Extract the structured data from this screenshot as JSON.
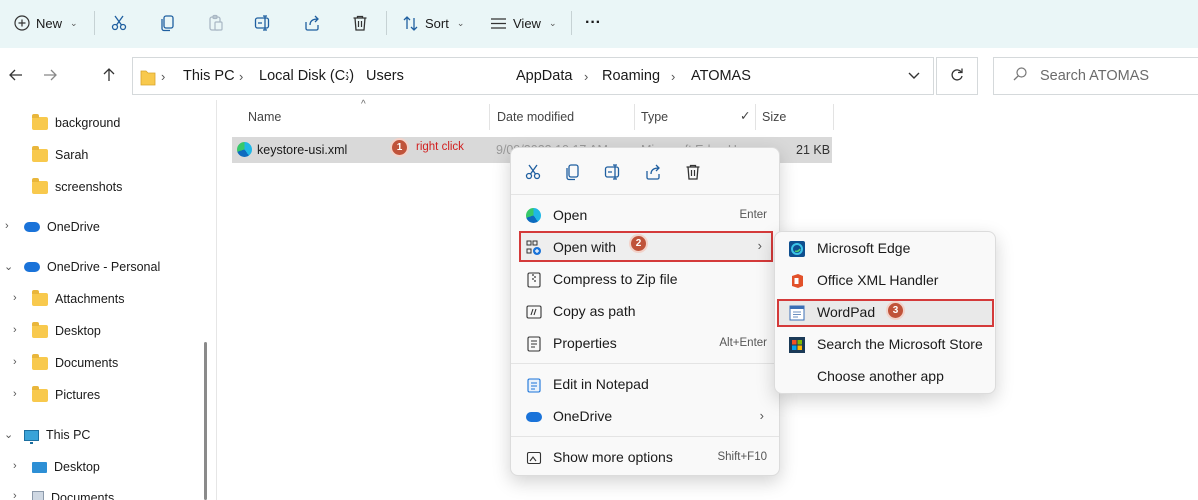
{
  "toolbar": {
    "new_label": "New",
    "sort_label": "Sort",
    "view_label": "View",
    "more_label": "···"
  },
  "address": {
    "crumbs": [
      "This PC",
      "Local Disk (C:)",
      "Users",
      "AppData",
      "Roaming",
      "ATOMAS"
    ],
    "separator": "›"
  },
  "search": {
    "placeholder": "Search ATOMAS"
  },
  "sidebar": {
    "items": [
      {
        "label": "background",
        "icon": "folder-icon"
      },
      {
        "label": "Sarah",
        "icon": "folder-icon"
      },
      {
        "label": "screenshots",
        "icon": "folder-icon"
      },
      {
        "label": "OneDrive",
        "icon": "onedrive-icon"
      },
      {
        "label": "OneDrive - Personal",
        "icon": "onedrive-icon"
      },
      {
        "label": "Attachments",
        "icon": "folder-icon"
      },
      {
        "label": "Desktop",
        "icon": "folder-icon"
      },
      {
        "label": "Documents",
        "icon": "folder-icon"
      },
      {
        "label": "Pictures",
        "icon": "folder-icon"
      },
      {
        "label": "This PC",
        "icon": "this-pc-icon"
      },
      {
        "label": "Desktop",
        "icon": "desktop-icon"
      },
      {
        "label": "Documents",
        "icon": "documents-icon"
      }
    ]
  },
  "file_list": {
    "columns": [
      "Name",
      "Date modified",
      "Type",
      "Size"
    ],
    "rows": [
      {
        "name": "keystore-usi.xml",
        "date": "9/09/2023 10:17 AM",
        "type": "Microsoft Edge H...",
        "size": "21 KB"
      }
    ]
  },
  "annotations": {
    "step1": "1",
    "step1_label": "right click",
    "step2": "2",
    "step3": "3"
  },
  "context_menu": {
    "quick_actions": [
      "cut-icon",
      "copy-icon",
      "rename-icon",
      "share-icon",
      "delete-icon"
    ],
    "items": [
      {
        "label": "Open",
        "shortcut": "Enter",
        "icon": "edge-icon"
      },
      {
        "label": "Open with",
        "shortcut": "",
        "icon": "open-with-icon",
        "submenu": true
      },
      {
        "label": "Compress to Zip file",
        "shortcut": "",
        "icon": "zip-icon"
      },
      {
        "label": "Copy as path",
        "shortcut": "",
        "icon": "copy-path-icon"
      },
      {
        "label": "Properties",
        "shortcut": "Alt+Enter",
        "icon": "properties-icon"
      },
      {
        "label": "Edit in Notepad",
        "shortcut": "",
        "icon": "notepad-icon"
      },
      {
        "label": "OneDrive",
        "shortcut": "",
        "icon": "onedrive-icon",
        "submenu": true
      },
      {
        "label": "Show more options",
        "shortcut": "Shift+F10",
        "icon": "more-options-icon"
      }
    ]
  },
  "open_with_menu": {
    "items": [
      {
        "label": "Microsoft Edge",
        "icon": "edge-icon"
      },
      {
        "label": "Office XML Handler",
        "icon": "office-icon"
      },
      {
        "label": "WordPad",
        "icon": "wordpad-icon"
      },
      {
        "label": "Search the Microsoft Store",
        "icon": "store-icon"
      },
      {
        "label": "Choose another app",
        "icon": ""
      }
    ]
  },
  "colors": {
    "toolbar_bg": "#eaf6f7",
    "highlight_red": "#d43a3a",
    "step_badge": "#c0533a",
    "folder_yellow": "#f8c94d"
  }
}
